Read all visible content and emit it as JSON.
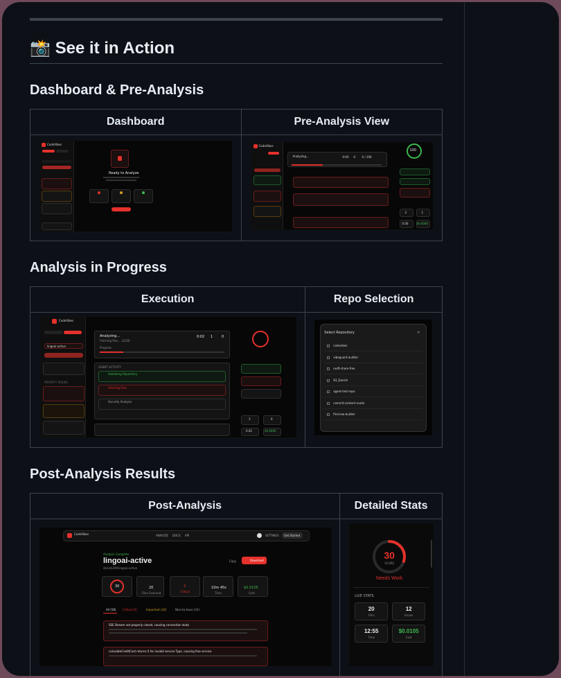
{
  "section": {
    "emoji": "📸",
    "title": "See it in Action"
  },
  "groups": [
    {
      "title": "Dashboard & Pre-Analysis",
      "headers": [
        "Dashboard",
        "Pre-Analysis View"
      ]
    },
    {
      "title": "Analysis in Progress",
      "headers": [
        "Execution",
        "Repo Selection"
      ]
    },
    {
      "title": "Post-Analysis Results",
      "headers": [
        "Post-Analysis",
        "Detailed Stats"
      ]
    }
  ],
  "app": {
    "name": "CodeVibes",
    "ready_title": "Ready to Analyze",
    "analyzing": "Analyzing...",
    "fetching": "Fetching files... (2/28)",
    "progress_label": "Progress",
    "progress_value": 0.19,
    "timer": "0:02",
    "agent_activity": "AGENT ACTIVITY",
    "activities": [
      "Validating Repository",
      "Fetching Files",
      "Security Analysis"
    ],
    "priority_issues": "PRIORITY ISSUES",
    "repo_active": "lingoai-active",
    "pre_score": "100",
    "pre_stats": [
      "0:00",
      "0",
      "0 / 100"
    ],
    "exec_stats": [
      "0:02",
      "1",
      "0"
    ],
    "exec_live": [
      "3",
      "0",
      "0.02",
      "$0.0000"
    ],
    "pre_live": [
      "2",
      "1",
      "0.00",
      "$0.0000"
    ]
  },
  "repo_modal": {
    "title": "Select Repository",
    "repos": [
      "codevibes",
      "vibeguard-auditor",
      "swift-share-free",
      "83_Danish",
      "agent-test-repo",
      "commit-content-router",
      "firecrew-builder"
    ]
  },
  "post": {
    "nav": [
      "ANALYZE",
      "DOCS",
      "API",
      "SETTINGS",
      "Get Started"
    ],
    "status": "Analysis Complete",
    "repo": "lingoai-active",
    "owner": "danish296/lingoai-active",
    "copy": "Copy",
    "download": "Download",
    "score": "30",
    "cards": [
      {
        "value": "20",
        "label": "Files Scanned"
      },
      {
        "value": "3",
        "label": "Critical"
      },
      {
        "value": "10m 45s",
        "label": "Time"
      },
      {
        "value": "$0.0105",
        "label": "Cost"
      }
    ],
    "tabs": [
      "All (58)",
      "Critical (3)",
      "Important (24)",
      "Nice-to-have (31)"
    ],
    "issues": [
      "SSE Stream not properly closed, causing connection leaks",
      "calculateCreditCost returns 0 for invalid service Type, causing free service"
    ]
  },
  "stats": {
    "score": "30",
    "score_label": "SCORE",
    "score_value": 0.3,
    "verdict": "Needs Work",
    "live_title": "LIVE STATS",
    "items": [
      {
        "value": "20",
        "label": "Files"
      },
      {
        "value": "12",
        "label": "Issues"
      },
      {
        "value": "12:55",
        "label": "Time"
      },
      {
        "value": "$0.0105",
        "label": "Cost"
      }
    ]
  }
}
